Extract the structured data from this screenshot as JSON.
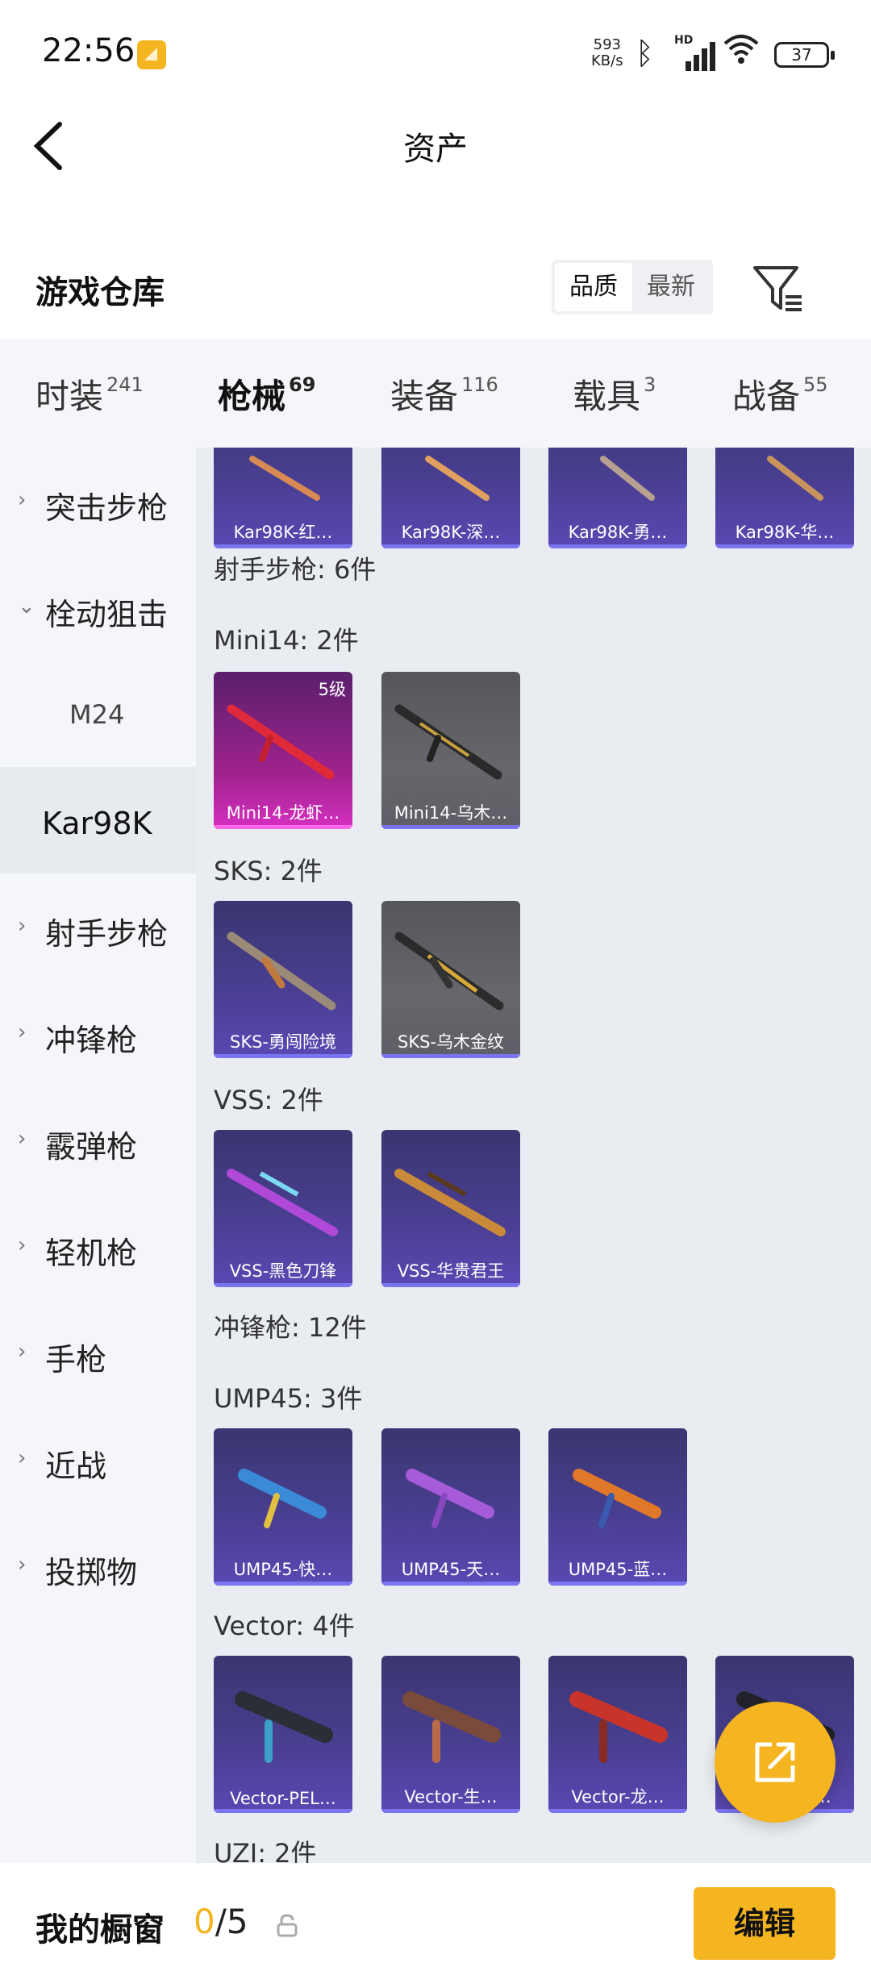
{
  "status_bar": {
    "time": "22:56",
    "net_speed_value": "593",
    "net_speed_unit": "KB/s",
    "signal_label": "HD",
    "battery": "37"
  },
  "header": {
    "title": "资产",
    "back_icon": "chevron-left-icon"
  },
  "warehouse": {
    "title": "游戏仓库",
    "sort_options": [
      "品质",
      "最新"
    ],
    "active_sort": "品质",
    "filter_icon": "filter-icon"
  },
  "tabs": [
    {
      "label": "时装",
      "count": "241"
    },
    {
      "label": "枪械",
      "count": "69"
    },
    {
      "label": "装备",
      "count": "116"
    },
    {
      "label": "载具",
      "count": "3"
    },
    {
      "label": "战备",
      "count": "55"
    }
  ],
  "active_tab": "枪械",
  "sidebar": {
    "items": [
      {
        "label": "突击步枪"
      },
      {
        "label": "栓动狙击"
      },
      {
        "label": "M24"
      },
      {
        "label": "Kar98K"
      },
      {
        "label": "射手步枪"
      },
      {
        "label": "冲锋枪"
      },
      {
        "label": "霰弹枪"
      },
      {
        "label": "轻机枪"
      },
      {
        "label": "手枪"
      },
      {
        "label": "近战"
      },
      {
        "label": "投掷物"
      }
    ],
    "selected": "Kar98K"
  },
  "content": {
    "kar_row": [
      "Kar98K-红…",
      "Kar98K-深…",
      "Kar98K-勇…",
      "Kar98K-华…"
    ],
    "section_marksman": "射手步枪: 6件",
    "group_mini14": "Mini14: 2件",
    "mini14_items": [
      {
        "name": "Mini14-龙虾…",
        "level": "5级"
      },
      {
        "name": "Mini14-乌木…"
      }
    ],
    "group_sks": "SKS: 2件",
    "sks_items": [
      "SKS-勇闯险境",
      "SKS-乌木金纹"
    ],
    "group_vss": "VSS: 2件",
    "vss_items": [
      "VSS-黑色刀锋",
      "VSS-华贵君王"
    ],
    "section_smg": "冲锋枪: 12件",
    "group_ump": "UMP45: 3件",
    "ump_items": [
      "UMP45-快…",
      "UMP45-天…",
      "UMP45-蓝…"
    ],
    "group_vector": "Vector: 4件",
    "vector_items": [
      "Vector-PEL…",
      "Vector-生…",
      "Vector-龙…",
      "Vector-黑…"
    ],
    "group_uzi": "UZI: 2件"
  },
  "fab": {
    "icon": "share-external-icon"
  },
  "bottom": {
    "label": "我的橱窗",
    "current": "0",
    "total": "/5",
    "lock_icon": "lock-icon",
    "edit_label": "编辑"
  },
  "colors": {
    "accent": "#f5b521",
    "card_purple": "#4a3f93",
    "card_grey": "#5e5f66",
    "card_pink": "#d62fc0"
  }
}
